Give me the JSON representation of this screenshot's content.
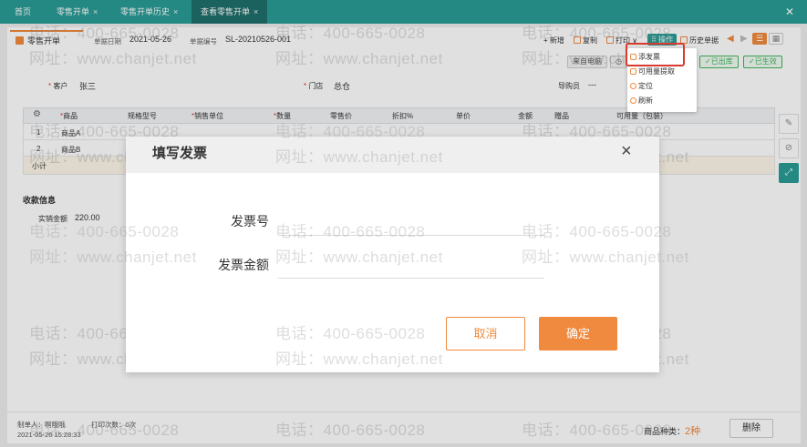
{
  "tabs": [
    {
      "label": "首页",
      "closable": false
    },
    {
      "label": "零售开单",
      "closable": true
    },
    {
      "label": "零售开单历史",
      "closable": true
    },
    {
      "label": "查看零售开单",
      "closable": true,
      "active": true
    }
  ],
  "tab_close_glyph": "×",
  "window_close": "✕",
  "doc_tab": "零售开单",
  "header": {
    "date_label": "单据日期",
    "date_value": "2021-05-26",
    "code_label": "单据编号",
    "code_value": "SL-20210526-001"
  },
  "toolbar": {
    "new": "新增",
    "copy": "复制",
    "print": "打印",
    "print_caret": "∨",
    "operate": "操作",
    "history": "历史单据"
  },
  "status_tags": {
    "source": "来自电脑",
    "outbound": "已出库",
    "effective": "已生效"
  },
  "dropdown_menu": [
    "添发票",
    "可用量提取",
    "定位",
    "刷新"
  ],
  "form": {
    "customer_label": "客户",
    "customer_value": "张三",
    "store_label": "门店",
    "store_value": "总仓",
    "guide_label": "导购员",
    "guide_value": "---"
  },
  "table": {
    "headers": [
      "商品",
      "规格型号",
      "销售单位",
      "数量",
      "零售价",
      "折扣%",
      "单价",
      "金额",
      "赠品",
      "可用量（包装）"
    ],
    "rows": [
      {
        "no": "1",
        "product": "商品A"
      },
      {
        "no": "2",
        "product": "商品B"
      }
    ],
    "subtotal_label": "小计"
  },
  "payment": {
    "section_title": "收款信息",
    "paid_label": "实销金额",
    "paid_value": "220.00"
  },
  "modal": {
    "title": "填写发票",
    "invoice_no_label": "发票号",
    "invoice_amount_label": "发票金额",
    "cancel": "取消",
    "confirm": "确定",
    "close_glyph": "×"
  },
  "footer": {
    "creator_label": "制单人：",
    "creator_value": "啊哦哦",
    "print_count_label": "打印次数：",
    "print_count_value": "0次",
    "timestamp": "2021-05-26 15:28:33",
    "product_kinds_label": "商品种类：",
    "product_kinds_value": "2种",
    "delete": "删除"
  },
  "watermark": {
    "phone": "电话：400-665-0028",
    "site": "网址：www.chanjet.net"
  },
  "colors": {
    "teal": "#2a9d96",
    "orange": "#f08a3e",
    "red": "#e23b3b",
    "green": "#3fb55a"
  },
  "icons": [
    "gear-icon",
    "note-icon",
    "link-icon",
    "expand-icon",
    "list-view-icon",
    "grid-view-icon"
  ]
}
